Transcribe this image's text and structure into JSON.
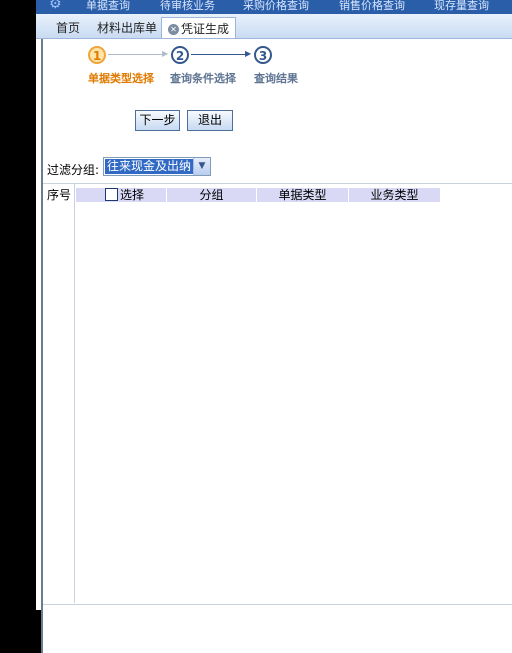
{
  "topnav": {
    "items": [
      "单据查询",
      "待审核业务",
      "采购价格查询",
      "销售价格查询",
      "现存量查询"
    ]
  },
  "tabs": [
    {
      "label": "首页"
    },
    {
      "label": "材料出库单"
    },
    {
      "label": "凭证生成",
      "active": true
    }
  ],
  "wizard": {
    "steps": [
      {
        "number": "1",
        "label": "单据类型选择",
        "current": true
      },
      {
        "number": "2",
        "label": "查询条件选择"
      },
      {
        "number": "3",
        "label": "查询结果"
      }
    ]
  },
  "buttons": {
    "next": "下一步",
    "exit": "退出"
  },
  "filter": {
    "label": "过滤分组:",
    "selected": "往来现金及出纳"
  },
  "grid": {
    "columns": [
      "序号",
      "选择",
      "分组",
      "单据类型",
      "业务类型"
    ],
    "rows": []
  },
  "colors": {
    "accent_orange": "#e07b00",
    "step_blue": "#34588e",
    "header_fill": "#d9d9f6",
    "selection_blue": "#316ac5"
  }
}
